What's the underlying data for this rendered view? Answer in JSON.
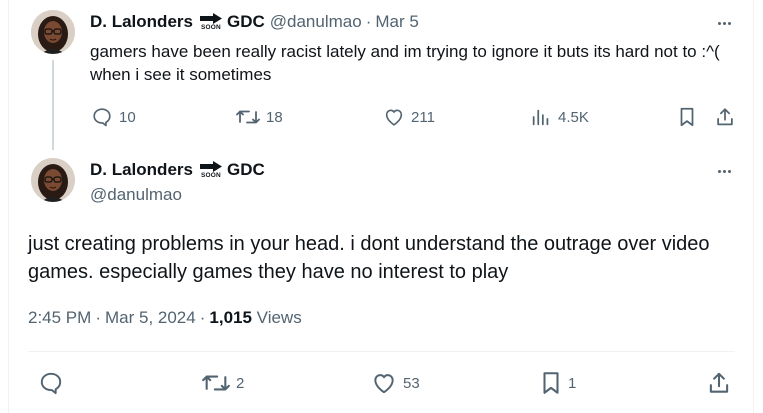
{
  "reply_tweet": {
    "display_name": "D. Lalonders",
    "soon_label": "SOON",
    "display_name_suffix": "GDC",
    "handle": "@danulmao",
    "separator": "·",
    "date": "Mar 5",
    "text": "gamers have been really racist lately and im trying to ignore it buts its hard not to :^( when i see it sometimes",
    "actions": {
      "replies": "10",
      "retweets": "18",
      "likes": "211",
      "views": "4.5K"
    }
  },
  "main_tweet": {
    "display_name": "D. Lalonders",
    "soon_label": "SOON",
    "display_name_suffix": "GDC",
    "handle": "@danulmao",
    "text": "just creating problems in your head. i dont understand the outrage over video games. especially games they have no interest to play",
    "time": "2:45 PM",
    "separator": "·",
    "date": "Mar 5, 2024",
    "views_count": "1,015",
    "views_label": "Views",
    "actions": {
      "retweets": "2",
      "likes": "53",
      "bookmarks": "1"
    }
  },
  "icons": {
    "reply": "reply-icon",
    "retweet": "retweet-icon",
    "like": "heart-icon",
    "views": "analytics-icon",
    "bookmark": "bookmark-icon",
    "share": "share-icon",
    "more": "more-icon",
    "arrow": "arrow-right-icon"
  },
  "colors": {
    "text": "#0f1419",
    "muted": "#536471",
    "divider": "#eff3f4",
    "thread_line": "#cfd9de"
  }
}
